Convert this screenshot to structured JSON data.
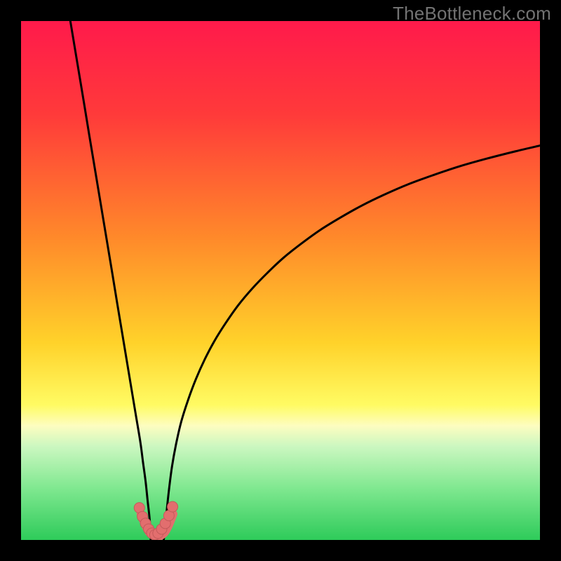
{
  "watermark": "TheBottleneck.com",
  "colors": {
    "stroke": "#000000",
    "marker_fill": "#e26e6e",
    "marker_stroke": "#c35a5a",
    "bg_black": "#000000",
    "band_yellow_pale": "#fdfdc0",
    "band_green_pale": "#cbf7c0",
    "band_green_mid": "#80e890",
    "band_green": "#2ecb5a"
  },
  "chart_data": {
    "type": "line",
    "title": "",
    "xlabel": "",
    "ylabel": "",
    "xlim": [
      0,
      100
    ],
    "ylim": [
      0,
      100
    ],
    "gradient_stops": [
      {
        "offset": 0,
        "color": "#ff1a4b"
      },
      {
        "offset": 18,
        "color": "#ff3a3a"
      },
      {
        "offset": 42,
        "color": "#ff8a2a"
      },
      {
        "offset": 62,
        "color": "#ffd22a"
      },
      {
        "offset": 74,
        "color": "#fffb63"
      },
      {
        "offset": 78,
        "color": "#fdfdc0"
      },
      {
        "offset": 82,
        "color": "#cbf7c0"
      },
      {
        "offset": 90,
        "color": "#80e890"
      },
      {
        "offset": 100,
        "color": "#2ecb5a"
      }
    ],
    "series": [
      {
        "name": "left-branch",
        "x": [
          9.5,
          10.4,
          11.3,
          12.2,
          13.1,
          14.0,
          14.9,
          15.8,
          16.7,
          17.6,
          18.5,
          19.4,
          20.3,
          21.2,
          22.1,
          23.0,
          23.5,
          24.0,
          24.4,
          24.8,
          25.0
        ],
        "y": [
          100.0,
          94.6,
          89.2,
          83.8,
          78.3,
          72.9,
          67.5,
          62.1,
          56.7,
          51.3,
          45.8,
          40.4,
          35.0,
          29.6,
          24.2,
          18.8,
          15.0,
          11.3,
          7.5,
          3.8,
          0.0
        ]
      },
      {
        "name": "right-branch",
        "x": [
          27.5,
          28.0,
          28.5,
          29.1,
          29.9,
          30.9,
          32.2,
          33.7,
          35.4,
          37.3,
          39.5,
          41.9,
          44.6,
          47.5,
          50.6,
          54.0,
          57.6,
          61.5,
          65.6,
          69.9,
          74.5,
          79.4,
          84.5,
          89.8,
          95.3,
          100.0
        ],
        "y": [
          0.0,
          4.9,
          9.6,
          14.2,
          18.6,
          22.9,
          27.0,
          31.0,
          34.8,
          38.4,
          41.9,
          45.3,
          48.5,
          51.5,
          54.4,
          57.1,
          59.7,
          62.1,
          64.4,
          66.5,
          68.5,
          70.3,
          72.0,
          73.5,
          74.9,
          76.0
        ]
      }
    ],
    "valley_floor": {
      "name": "valley-segment",
      "x": [
        23.0,
        23.8,
        24.6,
        25.4,
        26.2,
        27.0,
        27.8,
        28.6,
        29.4
      ],
      "y": [
        5.0,
        3.0,
        1.5,
        0.8,
        0.5,
        0.8,
        1.5,
        3.0,
        5.0
      ]
    },
    "markers": {
      "name": "valley-markers",
      "points": [
        {
          "x": 22.8,
          "y": 6.2
        },
        {
          "x": 23.4,
          "y": 4.5
        },
        {
          "x": 24.0,
          "y": 3.2
        },
        {
          "x": 24.6,
          "y": 2.1
        },
        {
          "x": 25.2,
          "y": 1.3
        },
        {
          "x": 25.8,
          "y": 1.0
        },
        {
          "x": 26.4,
          "y": 1.3
        },
        {
          "x": 27.1,
          "y": 2.1
        },
        {
          "x": 27.8,
          "y": 3.2
        },
        {
          "x": 28.5,
          "y": 4.7
        },
        {
          "x": 29.2,
          "y": 6.4
        }
      ]
    }
  }
}
